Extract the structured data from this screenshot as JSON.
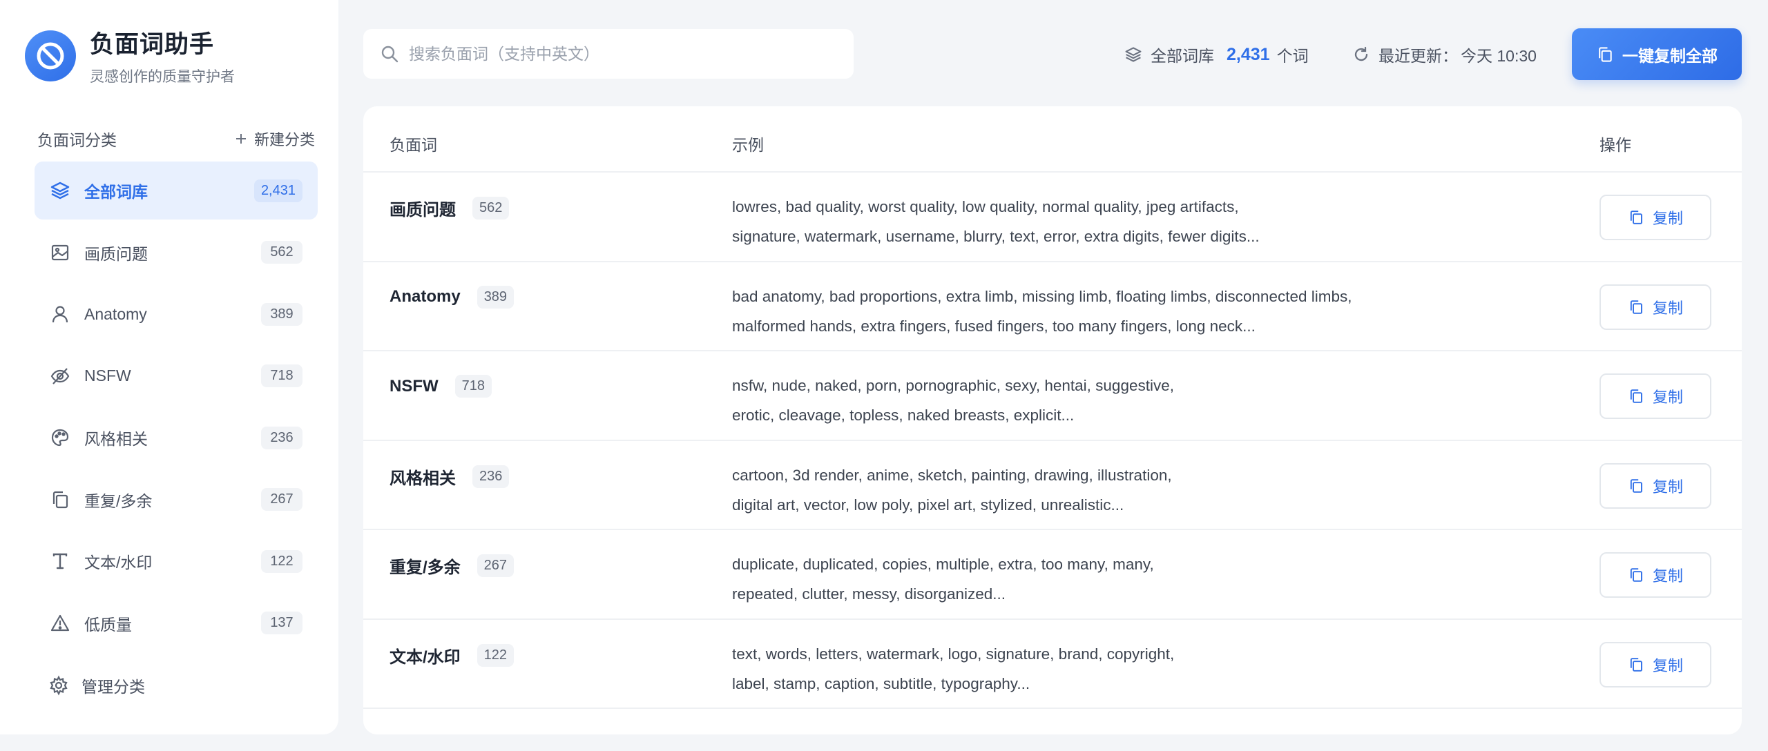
{
  "brand": {
    "title": "负面词助手",
    "subtitle": "灵感创作的质量守护者"
  },
  "sidebar": {
    "section_title": "负面词分类",
    "new_category_label": "新建分类",
    "manage_label": "管理分类",
    "items": [
      {
        "label": "全部词库",
        "count": "2,431",
        "icon": "layers-icon",
        "active": true
      },
      {
        "label": "画质问题",
        "count": "562",
        "icon": "image-icon"
      },
      {
        "label": "Anatomy",
        "count": "389",
        "icon": "user-icon"
      },
      {
        "label": "NSFW",
        "count": "718",
        "icon": "eye-off-icon"
      },
      {
        "label": "风格相关",
        "count": "236",
        "icon": "palette-icon"
      },
      {
        "label": "重复/多余",
        "count": "267",
        "icon": "copy-icon"
      },
      {
        "label": "文本/水印",
        "count": "122",
        "icon": "text-icon"
      },
      {
        "label": "低质量",
        "count": "137",
        "icon": "warning-icon"
      }
    ]
  },
  "search": {
    "placeholder": "搜索负面词（支持中英文）",
    "value": ""
  },
  "stats": {
    "library_label": "全部词库",
    "library_count": "2,431",
    "library_unit": "个词",
    "updated_label": "最近更新：",
    "updated_value": "今天 10:30"
  },
  "copy_all_label": "一键复制全部",
  "table": {
    "headers": {
      "word": "负面词",
      "example": "示例",
      "action": "操作"
    },
    "copy_label": "复制",
    "rows": [
      {
        "name": "画质问题",
        "count": "562",
        "line1": "lowres, bad quality, worst quality, low quality, normal quality, jpeg artifacts,",
        "line2": "signature, watermark, username, blurry, text, error, extra digits, fewer digits..."
      },
      {
        "name": "Anatomy",
        "count": "389",
        "line1": "bad anatomy, bad proportions, extra limb, missing limb, floating limbs, disconnected limbs,",
        "line2": "malformed hands, extra fingers, fused fingers, too many fingers, long neck..."
      },
      {
        "name": "NSFW",
        "count": "718",
        "line1": "nsfw, nude, naked, porn, pornographic, sexy, hentai, suggestive,",
        "line2": "erotic, cleavage, topless, naked breasts, explicit..."
      },
      {
        "name": "风格相关",
        "count": "236",
        "line1": "cartoon, 3d render, anime, sketch, painting, drawing, illustration,",
        "line2": "digital art, vector, low poly, pixel art, stylized, unrealistic..."
      },
      {
        "name": "重复/多余",
        "count": "267",
        "line1": "duplicate, duplicated, copies, multiple, extra, too many, many,",
        "line2": "repeated, clutter, messy, disorganized..."
      },
      {
        "name": "文本/水印",
        "count": "122",
        "line1": "text, words, letters, watermark, logo, signature, brand, copyright,",
        "line2": "label, stamp, caption, subtitle, typography..."
      }
    ]
  },
  "colors": {
    "accent": "#2f6fe8",
    "accent_light": "#e8f0fe"
  }
}
